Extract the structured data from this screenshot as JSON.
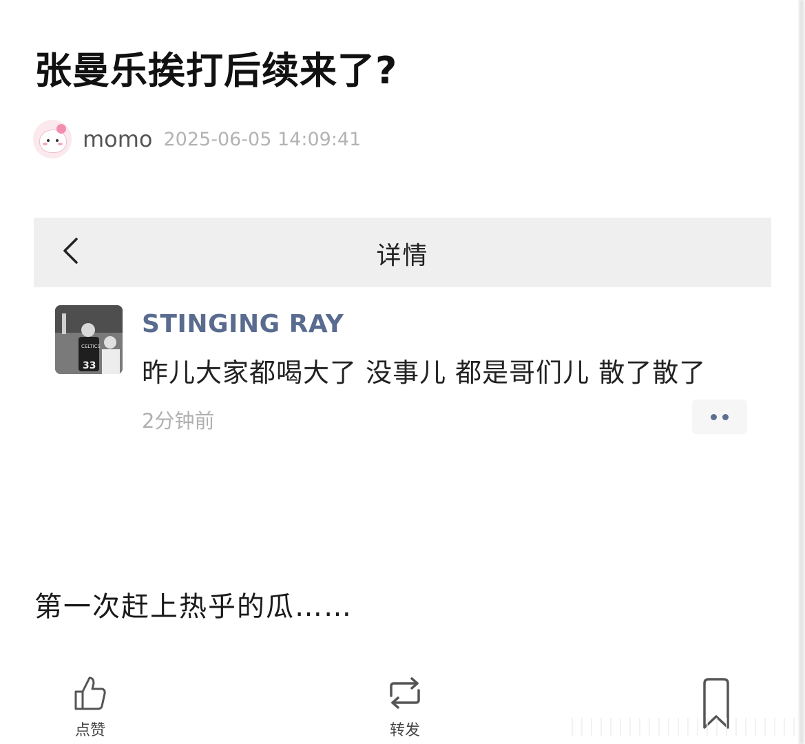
{
  "article": {
    "title": "张曼乐挨打后续来了?",
    "author": "momo",
    "timestamp": "2025-06-05 14:09:41",
    "body_text": "第一次赶上热乎的瓜……"
  },
  "screenshot": {
    "nav_title": "详情",
    "back_icon": "chevron-left-icon",
    "post": {
      "username": "STINGING RAY",
      "content": "昨儿大家都喝大了 没事儿 都是哥们儿 散了散了",
      "time": "2分钟前",
      "more_icon": "more-dots-icon",
      "avatar_jersey": "33",
      "avatar_jersey_text": "CELTICS"
    }
  },
  "actions": {
    "like_label": "点赞",
    "repost_label": "转发",
    "like_icon": "thumbs-up-icon",
    "repost_icon": "repost-icon",
    "favorite_icon": "bookmark-icon"
  },
  "colors": {
    "username": "#596b8e",
    "nav_bg": "#efefef",
    "avatar_bg": "#fbe9ee"
  }
}
